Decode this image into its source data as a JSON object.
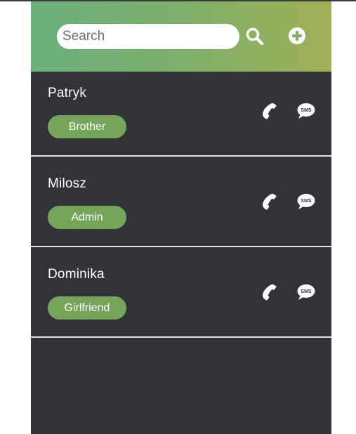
{
  "search": {
    "placeholder": "Search",
    "value": ""
  },
  "icons": {
    "search": "search-icon",
    "add": "plus-circle-icon",
    "call": "phone-icon",
    "sms": "sms-bubble-icon"
  },
  "sms_icon_text": "SMS",
  "colors": {
    "background": "#313339",
    "tag": "#74a65a",
    "header_gradient_start": "#6bb07c",
    "header_gradient_end": "#9fb055"
  },
  "contacts": [
    {
      "name": "Patryk",
      "tag": "Brother"
    },
    {
      "name": "Milosz",
      "tag": "Admin"
    },
    {
      "name": "Dominika",
      "tag": "Girlfriend"
    }
  ]
}
